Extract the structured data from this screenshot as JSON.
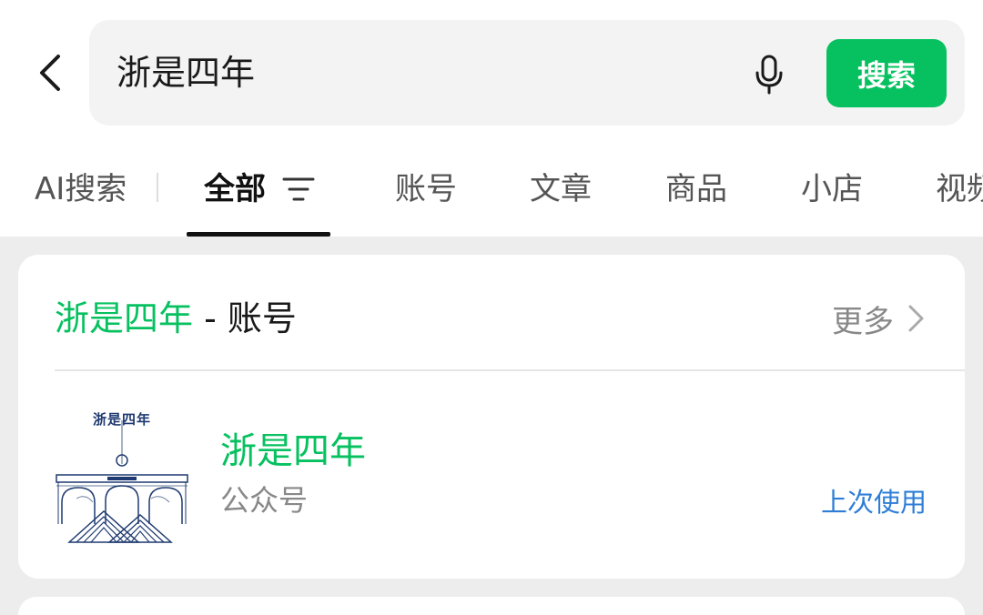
{
  "search": {
    "query": "浙是四年",
    "button_label": "搜索"
  },
  "tabs": [
    {
      "label": "AI搜索"
    },
    {
      "label": "全部",
      "active": true
    },
    {
      "label": "账号"
    },
    {
      "label": "文章"
    },
    {
      "label": "商品"
    },
    {
      "label": "小店"
    },
    {
      "label": "视频"
    }
  ],
  "accounts_section": {
    "title_keyword": "浙是四年",
    "title_suffix": " - 账号",
    "more_label": "更多",
    "account": {
      "avatar_text": "浙是四年",
      "name": "浙是四年",
      "type": "公众号",
      "badge": "上次使用"
    }
  },
  "colors": {
    "accent": "#07c160",
    "link": "#2e7ed7",
    "logo_blue": "#1f3a70"
  },
  "icons": [
    "back-chevron-icon",
    "microphone-icon",
    "filter-icon",
    "chevron-right-icon"
  ]
}
